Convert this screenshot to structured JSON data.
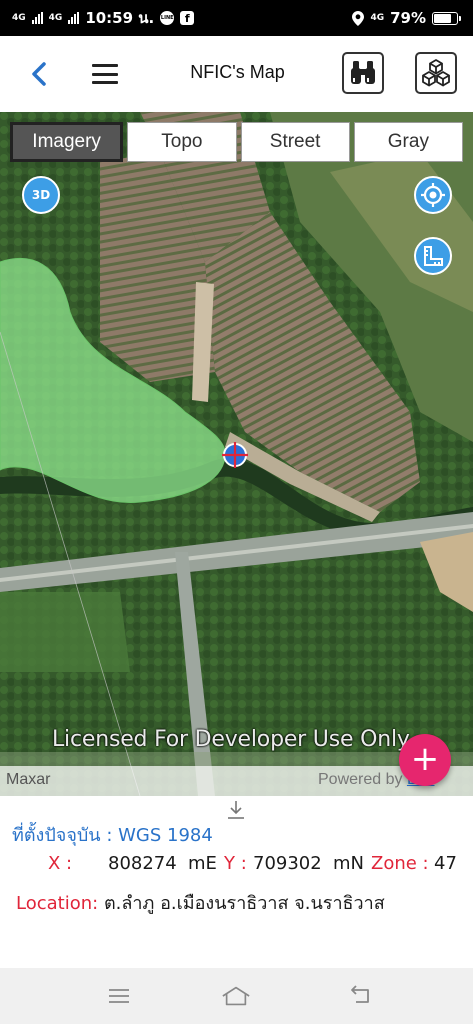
{
  "status_bar": {
    "signal_1": "4G",
    "signal_2": "4G",
    "time": "10:59 น.",
    "line_badge": "LINE",
    "facebook_badge": "f",
    "network": "4G",
    "battery": "79%",
    "battery_level": 0.79
  },
  "header": {
    "title": "NFIC's Map",
    "back_icon": "chevron-left-icon",
    "menu_icon": "hamburger-icon",
    "binoculars_icon": "binoculars-icon",
    "layers_icon": "cubes-icon"
  },
  "map": {
    "basemap_tabs": [
      {
        "label": "Imagery",
        "active": true
      },
      {
        "label": "Topo",
        "active": false
      },
      {
        "label": "Street",
        "active": false
      },
      {
        "label": "Gray",
        "active": false
      }
    ],
    "btn_3d_label": "3D",
    "watermark": "Licensed For Developer Use Only",
    "attribution_left": "Maxar",
    "attribution_right_prefix": "Powered by ",
    "attribution_right_link": "Esri",
    "fab_label": "+"
  },
  "info": {
    "crs_label": "ที่ตั้งปัจจุบัน : WGS 1984",
    "x_label": "X :",
    "x_value": "808274",
    "x_unit": "mE",
    "y_label": "Y :",
    "y_value": "709302",
    "y_unit": "mN",
    "zone_label": "Zone :",
    "zone_value": "47",
    "location_label": "Location:",
    "location_value": "ต.ลำภู อ.เมืองนราธิวาส จ.นราธิวาส"
  },
  "nav_bar": {
    "menu_icon": "recents-icon",
    "home_icon": "home-icon",
    "back_icon": "back-icon"
  },
  "colors": {
    "accent_blue": "#2a73c9",
    "label_red": "#e0263a",
    "fab_pink": "#e6266e",
    "map_button_blue": "#3d9ee6",
    "polygon_green": "#7bd07a"
  }
}
